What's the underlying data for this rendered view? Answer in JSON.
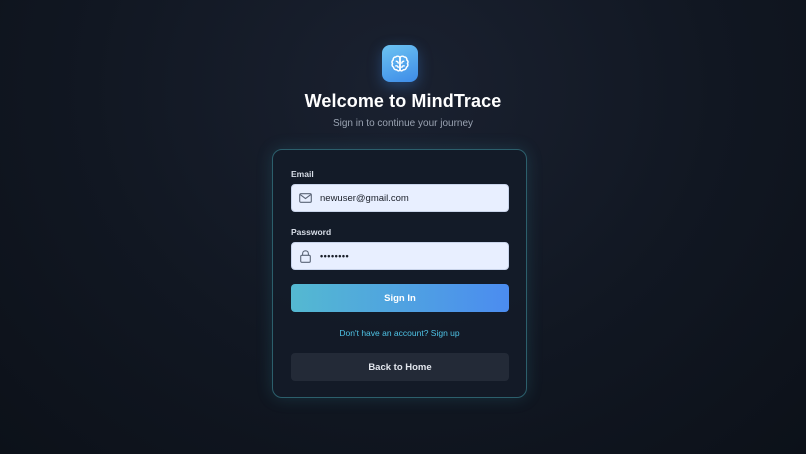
{
  "app": {
    "title": "Welcome to MindTrace",
    "subtitle": "Sign in to continue your journey",
    "logo_icon": "brain-icon"
  },
  "form": {
    "email_label": "Email",
    "email_value": "newuser@gmail.com",
    "email_icon": "mail-icon",
    "password_label": "Password",
    "password_value": "••••••••",
    "password_icon": "lock-icon",
    "signin_label": "Sign In",
    "signup_link": "Don't have an account? Sign up",
    "back_label": "Back to Home"
  },
  "colors": {
    "accent_start": "#54b9d1",
    "accent_end": "#4b8cf0",
    "link": "#4fc3e6",
    "background": "#111722",
    "card_border": "#2c5f6c"
  }
}
